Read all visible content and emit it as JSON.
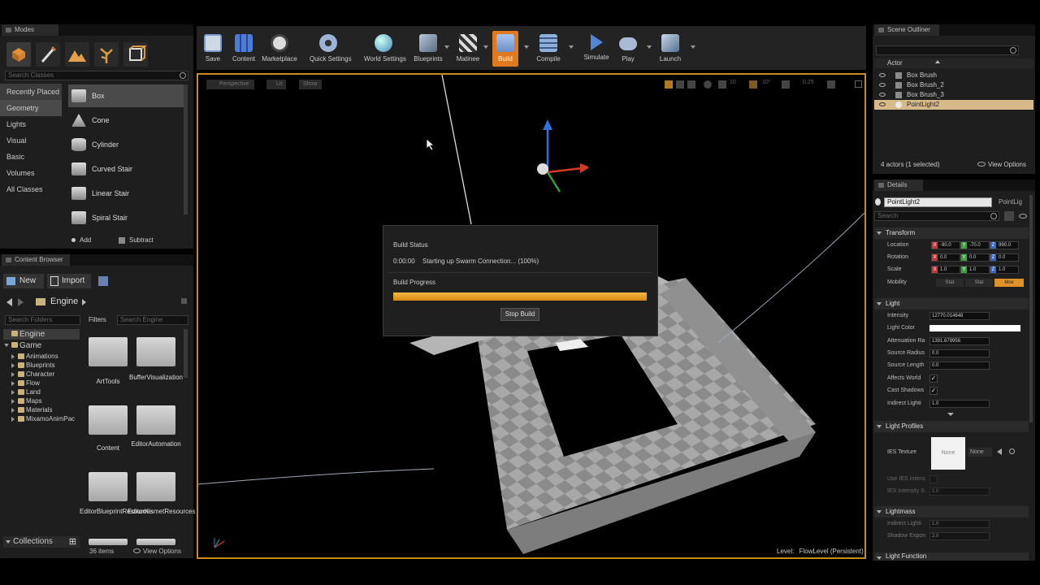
{
  "modes": {
    "tab_label": "Modes",
    "search_placeholder": "Search Classes",
    "categories": [
      "Recently Placed",
      "Geometry",
      "Lights",
      "Visual",
      "Basic",
      "Volumes",
      "All Classes"
    ],
    "items": [
      "Box",
      "Cone",
      "Cylinder",
      "Curved Stair",
      "Linear Stair",
      "Spiral Stair"
    ],
    "add_label": "Add",
    "subtract_label": "Subtract"
  },
  "toolbar": {
    "buttons": [
      "Save",
      "Content",
      "Marketplace",
      "Quick Settings",
      "World Settings",
      "Blueprints",
      "Matinee",
      "Build",
      "Compile",
      "Simulate",
      "Play",
      "Launch"
    ]
  },
  "viewport": {
    "perspective_label": "Perspective",
    "lit_label": "Lit",
    "show_label": "Show",
    "grid_snap": "10",
    "rot_snap": "10°",
    "scale_snap": "0.25",
    "cam_speed": "1",
    "level_label": "Level:",
    "level_name": "FlowLevel (Persistent)"
  },
  "build_dialog": {
    "status_header": "Build Status",
    "time": "0:00:00",
    "status_text": "Starting up Swarm Connection... (100%)",
    "progress_header": "Build Progress",
    "progress": 1.0,
    "stop_button": "Stop Build"
  },
  "content_browser": {
    "tab_label": "Content Browser",
    "new_label": "New",
    "import_label": "Import",
    "path_label": "Engine",
    "search_folders_placeholder": "Search Folders",
    "filters_label": "Filters",
    "search_placeholder": "Search Engine",
    "tree": [
      "Engine",
      "Game",
      "Animations",
      "Blueprints",
      "Character",
      "Flow",
      "Land",
      "Maps",
      "Materials",
      "MixamoAnimPac"
    ],
    "folders": [
      "ArtTools",
      "BufferVisualization",
      "Content",
      "EditorAutomation",
      "EditorBlueprintResources",
      "EditorKismetResources"
    ],
    "collections_label": "Collections",
    "item_count": "36 items",
    "view_options": "View Options"
  },
  "outliner": {
    "tab_label": "Scene Outliner",
    "column_label": "Actor",
    "actors": [
      "Box Brush",
      "Box Brush_2",
      "Box Brush_3",
      "PointLight2"
    ],
    "summary": "4 actors (1 selected)",
    "view_options": "View Options"
  },
  "details": {
    "tab_label": "Details",
    "name_value": "PointLight2",
    "class_label": "PointLig",
    "search_placeholder": "Search",
    "transform_header": "Transform",
    "location_label": "Location",
    "location": [
      "-90.0",
      "-70.0",
      "990.0"
    ],
    "rotation_label": "Rotation",
    "rotation": [
      "0.0",
      "0.0",
      "0.0"
    ],
    "scale_label": "Scale",
    "scale": [
      "1.0",
      "1.0",
      "1.0"
    ],
    "mobility_label": "Mobility",
    "mobility_options": [
      "Stat",
      "Stat",
      "Mov"
    ],
    "light_header": "Light",
    "intensity_label": "Intensity",
    "intensity": "12770.014648",
    "light_color_label": "Light Color",
    "attenuation_label": "Attenuation Ra",
    "attenuation": "1391.679956",
    "source_radius_label": "Source Radius",
    "source_radius": "0.0",
    "source_length_label": "Source Length",
    "source_length": "0.0",
    "affects_world_label": "Affects World",
    "cast_shadows_label": "Cast Shadows",
    "indirect_label": "Indirect Lighti",
    "indirect": "1.0",
    "light_profiles_header": "Light Profiles",
    "ies_texture_label": "IES Texture",
    "ies_thumb": "None",
    "ies_value": "None",
    "use_ies_label": "Use IES Intens",
    "ies_intensity_label": "IES Intensity S",
    "ies_intensity": "1.0",
    "lightmass_header": "Lightmass",
    "lm_indirect_label": "Indirect Lighti",
    "lm_indirect": "1.0",
    "shadow_exp_label": "Shadow Expon",
    "shadow_exp": "2.0",
    "light_function_header": "Light Function"
  },
  "colors": {
    "accent_orange": "#e8a317",
    "selection": "#d7b98a",
    "bg": "#1e1e1e"
  }
}
